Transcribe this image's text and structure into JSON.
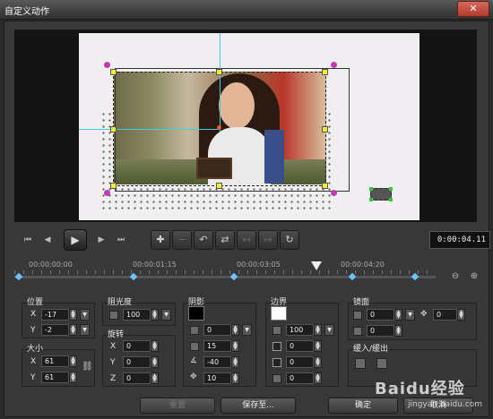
{
  "window": {
    "title": "自定义动作",
    "close_label": "✕"
  },
  "playback": {
    "timecode": "0:00:04.11"
  },
  "timeline": {
    "labels": [
      "00:00:00:00",
      "00:00:01:15",
      "00:00:03:05",
      "00:00:04:20"
    ]
  },
  "panels": {
    "position": {
      "title": "位置",
      "x_label": "X",
      "x": "-17",
      "y_label": "Y",
      "y": "-2"
    },
    "size": {
      "title": "大小",
      "x_label": "X",
      "x": "61",
      "y_label": "Y",
      "y": "61"
    },
    "opacity": {
      "title": "阻光度",
      "value": "100"
    },
    "rotation": {
      "title": "旋转",
      "x_label": "X",
      "x": "0",
      "y_label": "Y",
      "y": "0",
      "z_label": "Z",
      "z": "0"
    },
    "shadow": {
      "title": "阴影",
      "opacity": "0",
      "size": "15",
      "angle": "-40",
      "distance": "10",
      "color": "#000000"
    },
    "border": {
      "title": "边界",
      "opacity": "100",
      "v1": "0",
      "v2": "0",
      "v3": "0",
      "color": "#ffffff"
    },
    "mirror": {
      "title": "镜面",
      "v1": "0",
      "v2": "0",
      "v3": "0"
    },
    "fade": {
      "title": "缓入/缓出"
    }
  },
  "footer": {
    "reset": "重置",
    "save_as": "保存至...",
    "ok": "确定",
    "cancel": "取消"
  },
  "watermark": {
    "brand": "Baidu经验",
    "url": "jingyan.baidu.com"
  }
}
